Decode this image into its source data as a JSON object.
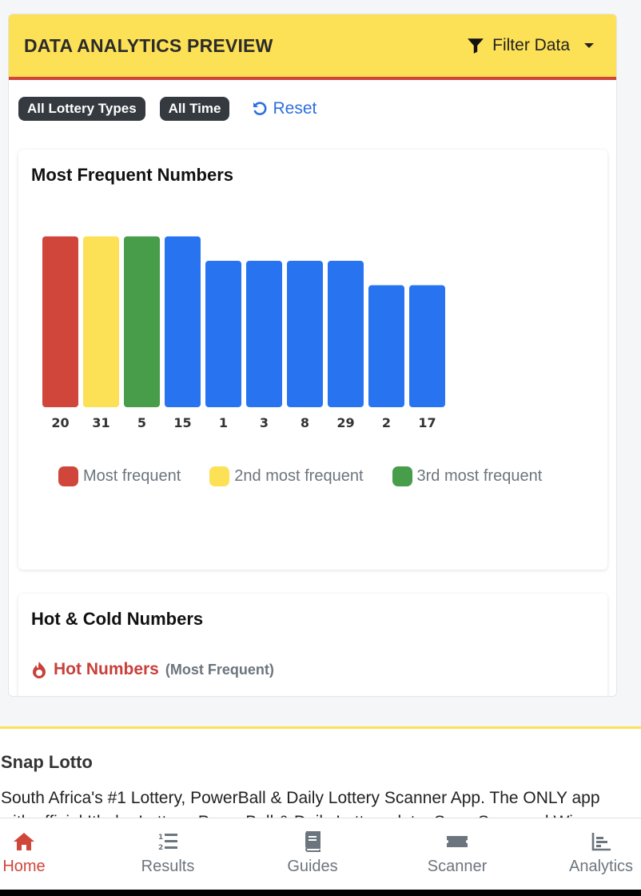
{
  "header": {
    "title": "DATA ANALYTICS PREVIEW",
    "filter_label": "Filter Data"
  },
  "filters": {
    "lottery_type": "All Lottery Types",
    "time_range": "All Time",
    "reset_label": "Reset"
  },
  "frequent_panel": {
    "title": "Most Frequent Numbers"
  },
  "chart_data": {
    "type": "bar",
    "categories": [
      "20",
      "31",
      "5",
      "15",
      "1",
      "3",
      "8",
      "29",
      "2",
      "17"
    ],
    "values": [
      7,
      7,
      7,
      7,
      6,
      6,
      6,
      6,
      5,
      5
    ],
    "colors": [
      "#d0463b",
      "#fce055",
      "#479d49",
      "#2874f0",
      "#2874f0",
      "#2874f0",
      "#2874f0",
      "#2874f0",
      "#2874f0",
      "#2874f0"
    ],
    "legend": [
      {
        "label": "Most frequent",
        "color": "#d0463b"
      },
      {
        "label": "2nd most frequent",
        "color": "#fce055"
      },
      {
        "label": "3rd most frequent",
        "color": "#479d49"
      }
    ]
  },
  "hot_cold_panel": {
    "title": "Hot & Cold Numbers",
    "hot_label": "Hot Numbers",
    "hot_sub": "(Most Frequent)"
  },
  "footer": {
    "title": "Snap Lotto",
    "text": "South Africa's #1 Lottery, PowerBall & Daily Lottery Scanner App. The ONLY app with official Ithuba Lottery, PowerBall & Daily Lottery data. Snap Scan and Win."
  },
  "nav": [
    {
      "label": "Home",
      "icon": "home-icon",
      "active": true
    },
    {
      "label": "Results",
      "icon": "list-ol-icon",
      "active": false
    },
    {
      "label": "Guides",
      "icon": "book-icon",
      "active": false
    },
    {
      "label": "Scanner",
      "icon": "ticket-icon",
      "active": false
    },
    {
      "label": "Analytics",
      "icon": "chart-icon",
      "active": false
    }
  ],
  "colors": {
    "accent_yellow": "#fce055",
    "accent_red": "#d0463b",
    "link_blue": "#2d6fe0",
    "bar_blue": "#2874f0",
    "bar_green": "#479d49"
  }
}
